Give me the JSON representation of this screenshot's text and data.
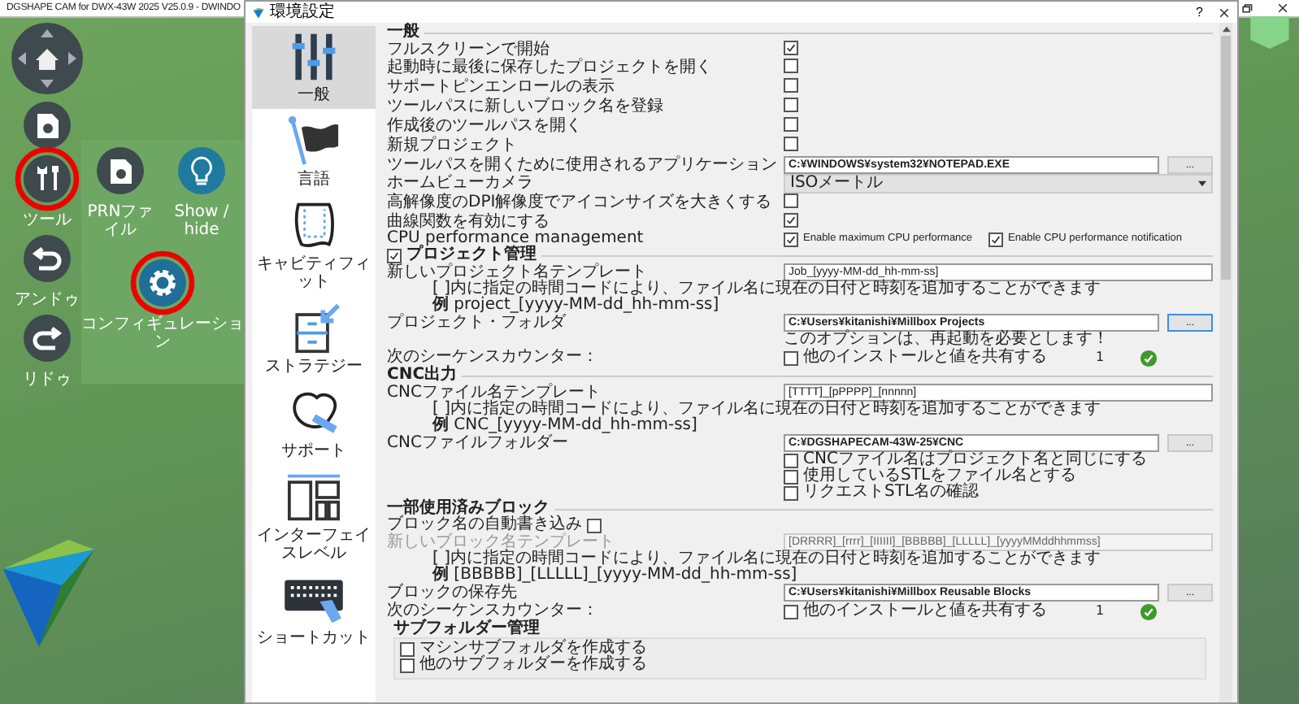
{
  "app": {
    "title": "DGSHAPE CAM for DWX-43W 2025 V25.0.9 - DWINDO"
  },
  "toolbar": [
    {
      "kind": "nav",
      "circled": false
    },
    {
      "kind": "file",
      "circled": false
    },
    {
      "kind": "tools",
      "label": "ツール",
      "circled": true
    },
    {
      "kind": "undo",
      "label": "アンドゥ",
      "circled": false
    },
    {
      "kind": "redo",
      "label": "リドゥ",
      "circled": false
    }
  ],
  "subpanel": [
    {
      "kind": "file",
      "label": "PRNファイル",
      "circled": false
    },
    {
      "kind": "bulb",
      "label": "Show / hide",
      "circled": false
    },
    {
      "kind": "gear",
      "label": "コンフィギュレーション",
      "circled": true
    }
  ],
  "dialog": {
    "title": "環境設定",
    "help_button": "?",
    "sidebar": [
      {
        "kind": "sliders",
        "label": "一般",
        "selected": true
      },
      {
        "kind": "flag",
        "label": "言語",
        "selected": false
      },
      {
        "kind": "cavity",
        "label": "キャビティフィット",
        "selected": false
      },
      {
        "kind": "strategy",
        "label": "ストラテジー",
        "selected": false
      },
      {
        "kind": "support",
        "label": "サポート",
        "selected": false
      },
      {
        "kind": "layout",
        "label": "インターフェイスレベル",
        "selected": false
      },
      {
        "kind": "keyboard",
        "label": "ショートカット",
        "selected": false
      }
    ],
    "sections": [
      {
        "title": "一般",
        "rows": [
          {
            "kind": "check",
            "label": "フルスクリーンで開始",
            "checked": true
          },
          {
            "kind": "check",
            "label": "起動時に最後に保存したプロジェクトを開く",
            "checked": false
          },
          {
            "kind": "check",
            "label": "サポートピンエンロールの表示",
            "checked": false
          },
          {
            "kind": "check",
            "label": "ツールパスに新しいブロック名を登録",
            "checked": false
          },
          {
            "kind": "check",
            "label": "作成後のツールパスを開く",
            "checked": false
          },
          {
            "kind": "check",
            "label": "新規プロジェクト",
            "checked": false
          },
          {
            "kind": "path",
            "label": "ツールパスを開くために使用されるアプリケーション",
            "value": "C:¥WINDOWS¥system32¥NOTEPAD.EXE",
            "button": "...",
            "focused": false
          },
          {
            "kind": "select",
            "label": "ホームビューカメラ",
            "value": "ISOメートル"
          },
          {
            "kind": "check",
            "label": "高解像度のDPI解像度でアイコンサイズを大きくする",
            "checked": false
          },
          {
            "kind": "check",
            "label": "曲線関数を有効にする",
            "checked": true
          },
          {
            "kind": "checks",
            "label": "CPU performance management",
            "options": [
              {
                "label": "Enable maximum CPU performance",
                "checked": true
              },
              {
                "label": "Enable CPU performance notification",
                "checked": true
              }
            ]
          }
        ]
      },
      {
        "title": "プロジェクト管理",
        "checked": true,
        "rows": [
          {
            "kind": "text",
            "label": "新しいプロジェクト名テンプレート",
            "value": "Job_[yyyy-MM-dd_hh-mm-ss]",
            "disabled": false
          },
          {
            "kind": "help",
            "lines": [
              "[ ]内に指定の時間コードにより、ファイル名に現在の日付と時刻を追加することができます",
              "**例** project_[yyyy-MM-dd_hh-mm-ss]"
            ]
          },
          {
            "kind": "path",
            "label": "プロジェクト・フォルダ",
            "value": "C:¥Users¥kitanishi¥Millbox Projects",
            "button": "...",
            "focused": true
          },
          {
            "kind": "note",
            "text": "このオプションは、再起動を必要とします！"
          },
          {
            "kind": "counter",
            "label": "次のシーケンスカウンター：",
            "option": {
              "label": "他のインストールと値を共有する",
              "checked": false
            },
            "value": "1"
          }
        ]
      },
      {
        "title": "CNC出力",
        "rows": [
          {
            "kind": "text",
            "label": "CNCファイル名テンプレート",
            "value": "[TTTT]_[pPPPP]_[nnnnn]",
            "disabled": false
          },
          {
            "kind": "help",
            "lines": [
              "[ ]内に指定の時間コードにより、ファイル名に現在の日付と時刻を追加することができます",
              "**例** CNC_[yyyy-MM-dd_hh-mm-ss]"
            ]
          },
          {
            "kind": "path",
            "label": "CNCファイルフォルダー",
            "value": "C:¥DGSHAPECAM-43W-25¥CNC",
            "button": "...",
            "focused": false
          },
          {
            "kind": "option",
            "label": "CNCファイル名はプロジェクト名と同じにする",
            "checked": false
          },
          {
            "kind": "option",
            "label": "使用しているSTLをファイル名とする",
            "checked": false
          },
          {
            "kind": "option",
            "label": "リクエストSTL名の確認",
            "checked": false
          }
        ]
      },
      {
        "title": "一部使用済みブロック",
        "rows": [
          {
            "kind": "inline_check",
            "label": "ブロック名の自動書き込み",
            "checked": false
          },
          {
            "kind": "text",
            "label": "新しいブロック名テンプレート",
            "value": "[DRRRR]_[rrrr]_[IIIIII]_[BBBBB]_[LLLLL]_[yyyyMMddhhmmss]",
            "disabled": true
          },
          {
            "kind": "help",
            "lines": [
              "[ ]内に指定の時間コードにより、ファイル名に現在の日付と時刻を追加することができます",
              "**例** [BBBBB]_[LLLLL]_[yyyy-MM-dd_hh-mm-ss]"
            ]
          },
          {
            "kind": "path",
            "label": "ブロックの保存先",
            "value": "C:¥Users¥kitanishi¥Millbox Reusable Blocks",
            "button": "...",
            "focused": false
          },
          {
            "kind": "counter",
            "label": "次のシーケンスカウンター：",
            "option": {
              "label": "他のインストールと値を共有する",
              "checked": false
            },
            "value": "1"
          },
          {
            "kind": "group",
            "title": "サブフォルダー管理",
            "options": [
              {
                "label": "マシンサブフォルダを作成する",
                "checked": false
              },
              {
                "label": "他のサブフォルダーを作成する",
                "checked": false
              }
            ]
          }
        ]
      }
    ]
  }
}
